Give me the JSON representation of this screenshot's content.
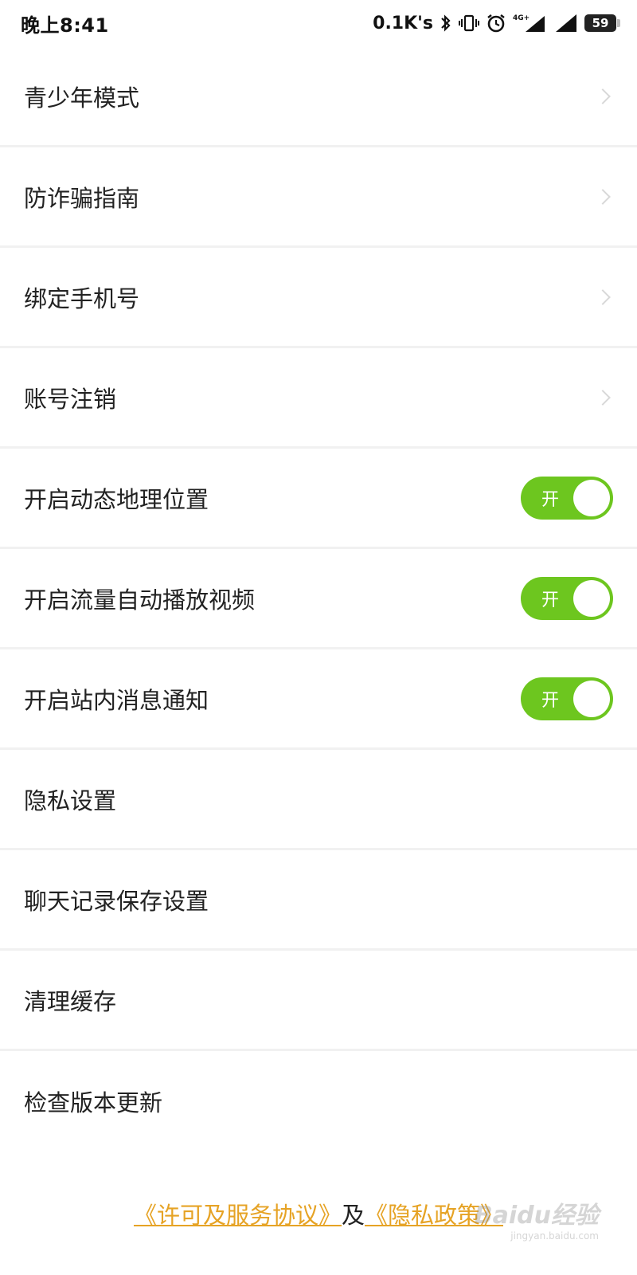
{
  "status_bar": {
    "time": "晚上8:41",
    "net_speed": "0.1K's",
    "network_type": "4G+",
    "battery_level": "59",
    "icons": [
      "bluetooth-icon",
      "vibrate-icon",
      "alarm-icon",
      "signal-4g-icon",
      "signal-icon",
      "battery-icon"
    ]
  },
  "settings": {
    "rows": [
      {
        "label": "青少年模式",
        "type": "link"
      },
      {
        "label": "防诈骗指南",
        "type": "link"
      },
      {
        "label": "绑定手机号",
        "type": "link"
      },
      {
        "label": "账号注销",
        "type": "link"
      },
      {
        "label": "开启动态地理位置",
        "type": "toggle",
        "toggle_label": "开",
        "on": true
      },
      {
        "label": "开启流量自动播放视频",
        "type": "toggle",
        "toggle_label": "开",
        "on": true
      },
      {
        "label": "开启站内消息通知",
        "type": "toggle",
        "toggle_label": "开",
        "on": true
      },
      {
        "label": "隐私设置",
        "type": "plain"
      },
      {
        "label": "聊天记录保存设置",
        "type": "plain"
      },
      {
        "label": "清理缓存",
        "type": "plain"
      },
      {
        "label": "检查版本更新",
        "type": "plain"
      }
    ]
  },
  "footer": {
    "license_link": "《许可及服务协议》",
    "separator": "及",
    "privacy_link": "《隐私政策》"
  },
  "watermark": {
    "main": "Baidu经验",
    "sub": "jingyan.baidu.com"
  },
  "colors": {
    "toggle_on": "#6dc61f",
    "link": "#e6a325",
    "divider": "#f1f1f1"
  }
}
